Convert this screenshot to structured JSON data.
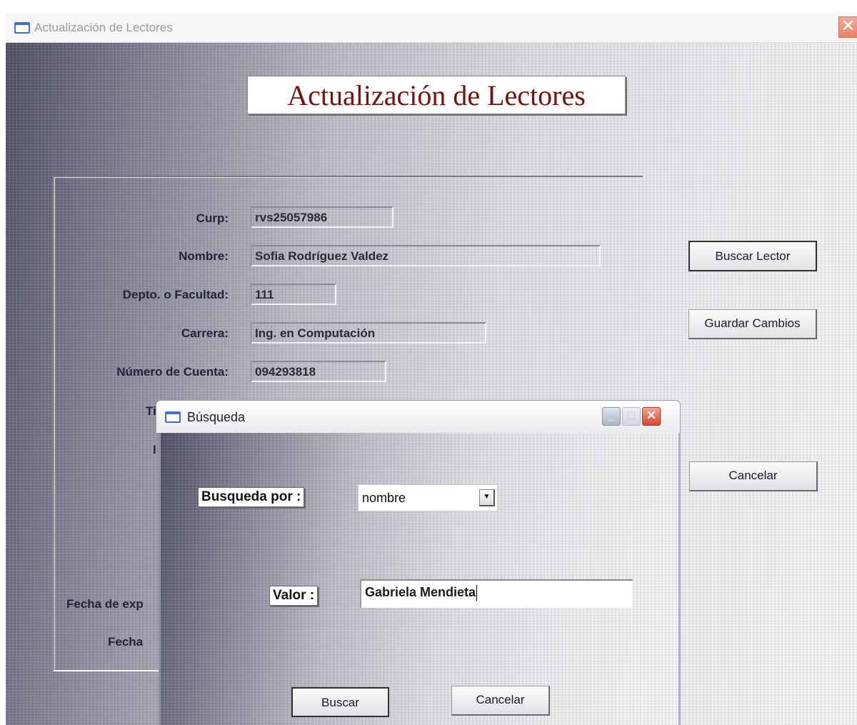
{
  "main_window": {
    "title": "Actualización de Lectores",
    "close_glyph": "✕",
    "heading": "Actualización de Lectores",
    "fields": [
      {
        "label": "Curp:",
        "value": "rvs25057986"
      },
      {
        "label": "Nombre:",
        "value": "Sofia Rodríguez Valdez"
      },
      {
        "label": "Depto. o Facultad:",
        "value": "111"
      },
      {
        "label": "Carrera:",
        "value": "Ing. en Computación"
      },
      {
        "label": "Número de Cuenta:",
        "value": "094293818"
      }
    ],
    "partial_labels": {
      "tipo": "Ti",
      "row7": "I",
      "fecha_expedicion": "Fecha de exp",
      "fecha": "Fecha"
    },
    "buttons": {
      "buscar_lector": "Buscar Lector",
      "guardar_cambios": "Guardar Cambios",
      "cancelar": "Cancelar"
    }
  },
  "dialog": {
    "title": "Búsqueda",
    "search_by_label": "Busqueda por :",
    "search_by_value": "nombre",
    "value_label": "Valor :",
    "value_input": "Gabriela Mendieta",
    "buttons": {
      "buscar": "Buscar",
      "cancelar": "Cancelar"
    },
    "controls": {
      "minimize": "_",
      "maximize": "□",
      "close": "✕"
    }
  },
  "icons": [
    "window-icon",
    "close-icon",
    "minimize-icon",
    "maximize-icon",
    "dropdown-arrow-icon"
  ],
  "colors": {
    "heading_text": "#7a1010",
    "close_button": "#d8452b",
    "window_icon": "#3d6fd6"
  }
}
